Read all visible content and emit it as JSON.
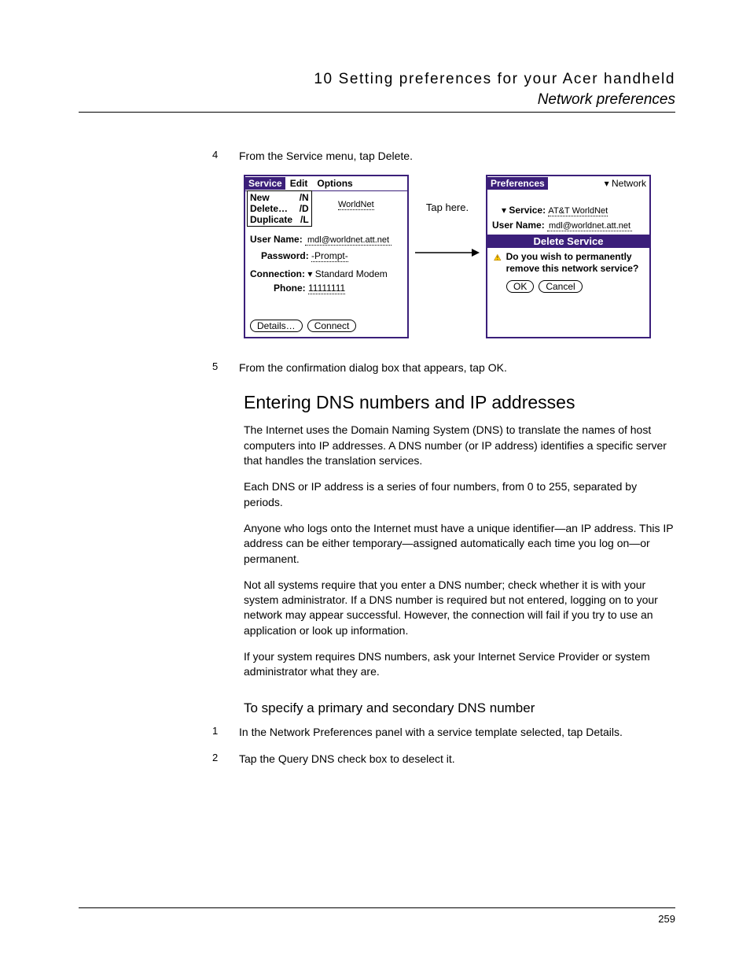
{
  "header": {
    "line1": "10 Setting preferences for your Acer handheld",
    "line2": "Network preferences"
  },
  "steps_a": [
    {
      "num": "4",
      "text": "From the Service menu, tap Delete."
    }
  ],
  "palm_left": {
    "title_menu_active": "Service",
    "title_menu_items": [
      "Edit",
      "Options"
    ],
    "dropdown": [
      {
        "label": "New",
        "short": "/N"
      },
      {
        "label": "Delete…",
        "short": "/D"
      },
      {
        "label": "Duplicate",
        "short": "/L"
      }
    ],
    "underlying_service_value": "WorldNet",
    "user_name_label": "User Name:",
    "user_name_value": "mdl@worldnet.att.net",
    "password_label": "Password:",
    "password_value": "-Prompt-",
    "connection_label": "Connection:",
    "connection_value": "Standard Modem",
    "phone_label": "Phone:",
    "phone_value": "11111111",
    "button_details": "Details…",
    "button_connect": "Connect"
  },
  "tap_here_label": "Tap here.",
  "palm_right": {
    "title": "Preferences",
    "selector_value": "Network",
    "service_label": "Service:",
    "service_value": "AT&T WorldNet",
    "user_name_label": "User Name:",
    "user_name_value": "mdl@worldnet.att.net",
    "delete_banner": "Delete Service",
    "confirm_text": "Do you wish to permanently remove this network service?",
    "ok_label": "OK",
    "cancel_label": "Cancel"
  },
  "steps_b": [
    {
      "num": "5",
      "text": "From the confirmation dialog box that appears, tap OK."
    }
  ],
  "section": {
    "heading": "Entering DNS numbers and IP addresses",
    "p1": "The Internet uses the Domain Naming System (DNS) to translate the names of host computers into IP addresses. A DNS number (or IP address) identifies a specific server that handles the translation services.",
    "p2": "Each DNS or IP address is a series of four numbers, from 0 to 255, separated by periods.",
    "p3": "Anyone who logs onto the Internet must have a unique identifier—an IP address. This IP address can be either temporary—assigned automatically each time you log on—or permanent.",
    "p4": "Not all systems require that you enter a DNS number; check whether it is with your system administrator. If a DNS number is required but not entered, logging on to your network may appear successful. However, the connection will fail if you try to use an application or look up information.",
    "p5": "If your system requires DNS numbers, ask your Internet Service Provider or system administrator what they are.",
    "sub_heading": "To specify a primary and secondary DNS number",
    "sub_steps": [
      {
        "num": "1",
        "text": "In the Network Preferences panel with a service template selected, tap Details."
      },
      {
        "num": "2",
        "text": "Tap the Query DNS check box to deselect it."
      }
    ]
  },
  "page_number": "259"
}
